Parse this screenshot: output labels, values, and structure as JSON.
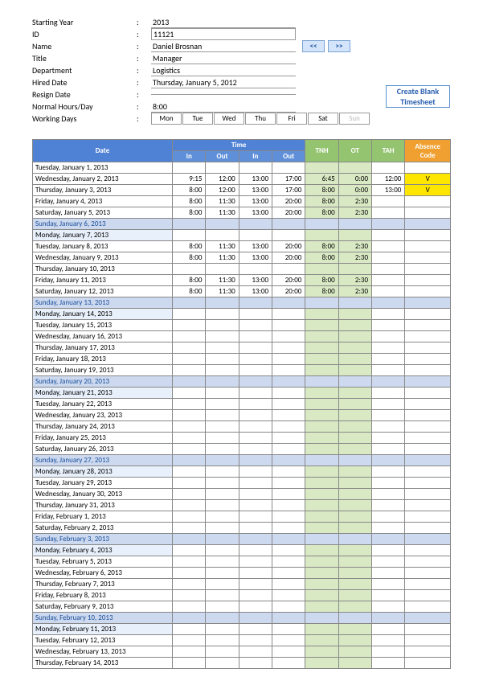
{
  "info": {
    "startingYear": {
      "label": "Starting Year",
      "value": "2013"
    },
    "id": {
      "label": "ID",
      "value": "11121"
    },
    "name": {
      "label": "Name",
      "value": "Daniel Brosnan"
    },
    "title": {
      "label": "Title",
      "value": "Manager"
    },
    "department": {
      "label": "Department",
      "value": "Logistics"
    },
    "hiredDate": {
      "label": "Hired Date",
      "value": "Thursday, January 5, 2012"
    },
    "resignDate": {
      "label": "Resign Date",
      "value": ""
    },
    "normalHours": {
      "label": "Normal Hours/Day",
      "value": "8:00"
    },
    "workingDays": {
      "label": "Working Days"
    }
  },
  "nav": {
    "prev": "<<",
    "next": ">>"
  },
  "createBlank": "Create Blank Timesheet",
  "days": [
    "Mon",
    "Tue",
    "Wed",
    "Thu",
    "Fri",
    "Sat",
    "Sun"
  ],
  "headers": {
    "date": "Date",
    "time": "Time",
    "in": "In",
    "out": "Out",
    "tnh": "TNH",
    "ot": "OT",
    "tah": "TAH",
    "absence": "Absence Code"
  },
  "rows": [
    {
      "date": "Tuesday, January 1, 2013",
      "cls": ""
    },
    {
      "date": "Wednesday, January 2, 2013",
      "in1": "9:15",
      "out1": "12:00",
      "in2": "13:00",
      "out2": "17:00",
      "tnh": "6:45",
      "ot": "0:00",
      "tah": "12:00",
      "abs": "V"
    },
    {
      "date": "Thursday, January 3, 2013",
      "in1": "8:00",
      "out1": "12:00",
      "in2": "13:00",
      "out2": "17:00",
      "tnh": "8:00",
      "ot": "0:00",
      "tah": "13:00",
      "abs": "V"
    },
    {
      "date": "Friday, January 4, 2013",
      "in1": "8:00",
      "out1": "11:30",
      "in2": "13:00",
      "out2": "20:00",
      "tnh": "8:00",
      "ot": "2:30"
    },
    {
      "date": "Saturday, January 5, 2013",
      "in1": "8:00",
      "out1": "11:30",
      "in2": "13:00",
      "out2": "20:00",
      "tnh": "8:00",
      "ot": "2:30"
    },
    {
      "date": "Sunday, January 6, 2013",
      "cls": "sunday"
    },
    {
      "date": "Monday, January 7, 2013",
      "cls": "monday"
    },
    {
      "date": "Tuesday, January 8, 2013",
      "in1": "8:00",
      "out1": "11:30",
      "in2": "13:00",
      "out2": "20:00",
      "tnh": "8:00",
      "ot": "2:30"
    },
    {
      "date": "Wednesday, January 9, 2013",
      "in1": "8:00",
      "out1": "11:30",
      "in2": "13:00",
      "out2": "20:00",
      "tnh": "8:00",
      "ot": "2:30"
    },
    {
      "date": "Thursday, January 10, 2013"
    },
    {
      "date": "Friday, January 11, 2013",
      "in1": "8:00",
      "out1": "11:30",
      "in2": "13:00",
      "out2": "20:00",
      "tnh": "8:00",
      "ot": "2:30"
    },
    {
      "date": "Saturday, January 12, 2013",
      "in1": "8:00",
      "out1": "11:30",
      "in2": "13:00",
      "out2": "20:00",
      "tnh": "8:00",
      "ot": "2:30"
    },
    {
      "date": "Sunday, January 13, 2013",
      "cls": "sunday"
    },
    {
      "date": "Monday, January 14, 2013",
      "cls": "monday"
    },
    {
      "date": "Tuesday, January 15, 2013"
    },
    {
      "date": "Wednesday, January 16, 2013"
    },
    {
      "date": "Thursday, January 17, 2013"
    },
    {
      "date": "Friday, January 18, 2013"
    },
    {
      "date": "Saturday, January 19, 2013"
    },
    {
      "date": "Sunday, January 20, 2013",
      "cls": "sunday"
    },
    {
      "date": "Monday, January 21, 2013",
      "cls": "monday"
    },
    {
      "date": "Tuesday, January 22, 2013"
    },
    {
      "date": "Wednesday, January 23, 2013"
    },
    {
      "date": "Thursday, January 24, 2013"
    },
    {
      "date": "Friday, January 25, 2013"
    },
    {
      "date": "Saturday, January 26, 2013"
    },
    {
      "date": "Sunday, January 27, 2013",
      "cls": "sunday"
    },
    {
      "date": "Monday, January 28, 2013",
      "cls": "monday"
    },
    {
      "date": "Tuesday, January 29, 2013"
    },
    {
      "date": "Wednesday, January 30, 2013"
    },
    {
      "date": "Thursday, January 31, 2013"
    },
    {
      "date": "Friday, February 1, 2013"
    },
    {
      "date": "Saturday, February 2, 2013"
    },
    {
      "date": "Sunday, February 3, 2013",
      "cls": "sunday"
    },
    {
      "date": "Monday, February 4, 2013",
      "cls": "monday"
    },
    {
      "date": "Tuesday, February 5, 2013"
    },
    {
      "date": "Wednesday, February 6, 2013"
    },
    {
      "date": "Thursday, February 7, 2013"
    },
    {
      "date": "Friday, February 8, 2013"
    },
    {
      "date": "Saturday, February 9, 2013"
    },
    {
      "date": "Sunday, February 10, 2013",
      "cls": "sunday"
    },
    {
      "date": "Monday, February 11, 2013",
      "cls": "monday"
    },
    {
      "date": "Tuesday, February 12, 2013"
    },
    {
      "date": "Wednesday, February 13, 2013"
    },
    {
      "date": "Thursday, February 14, 2013"
    }
  ]
}
